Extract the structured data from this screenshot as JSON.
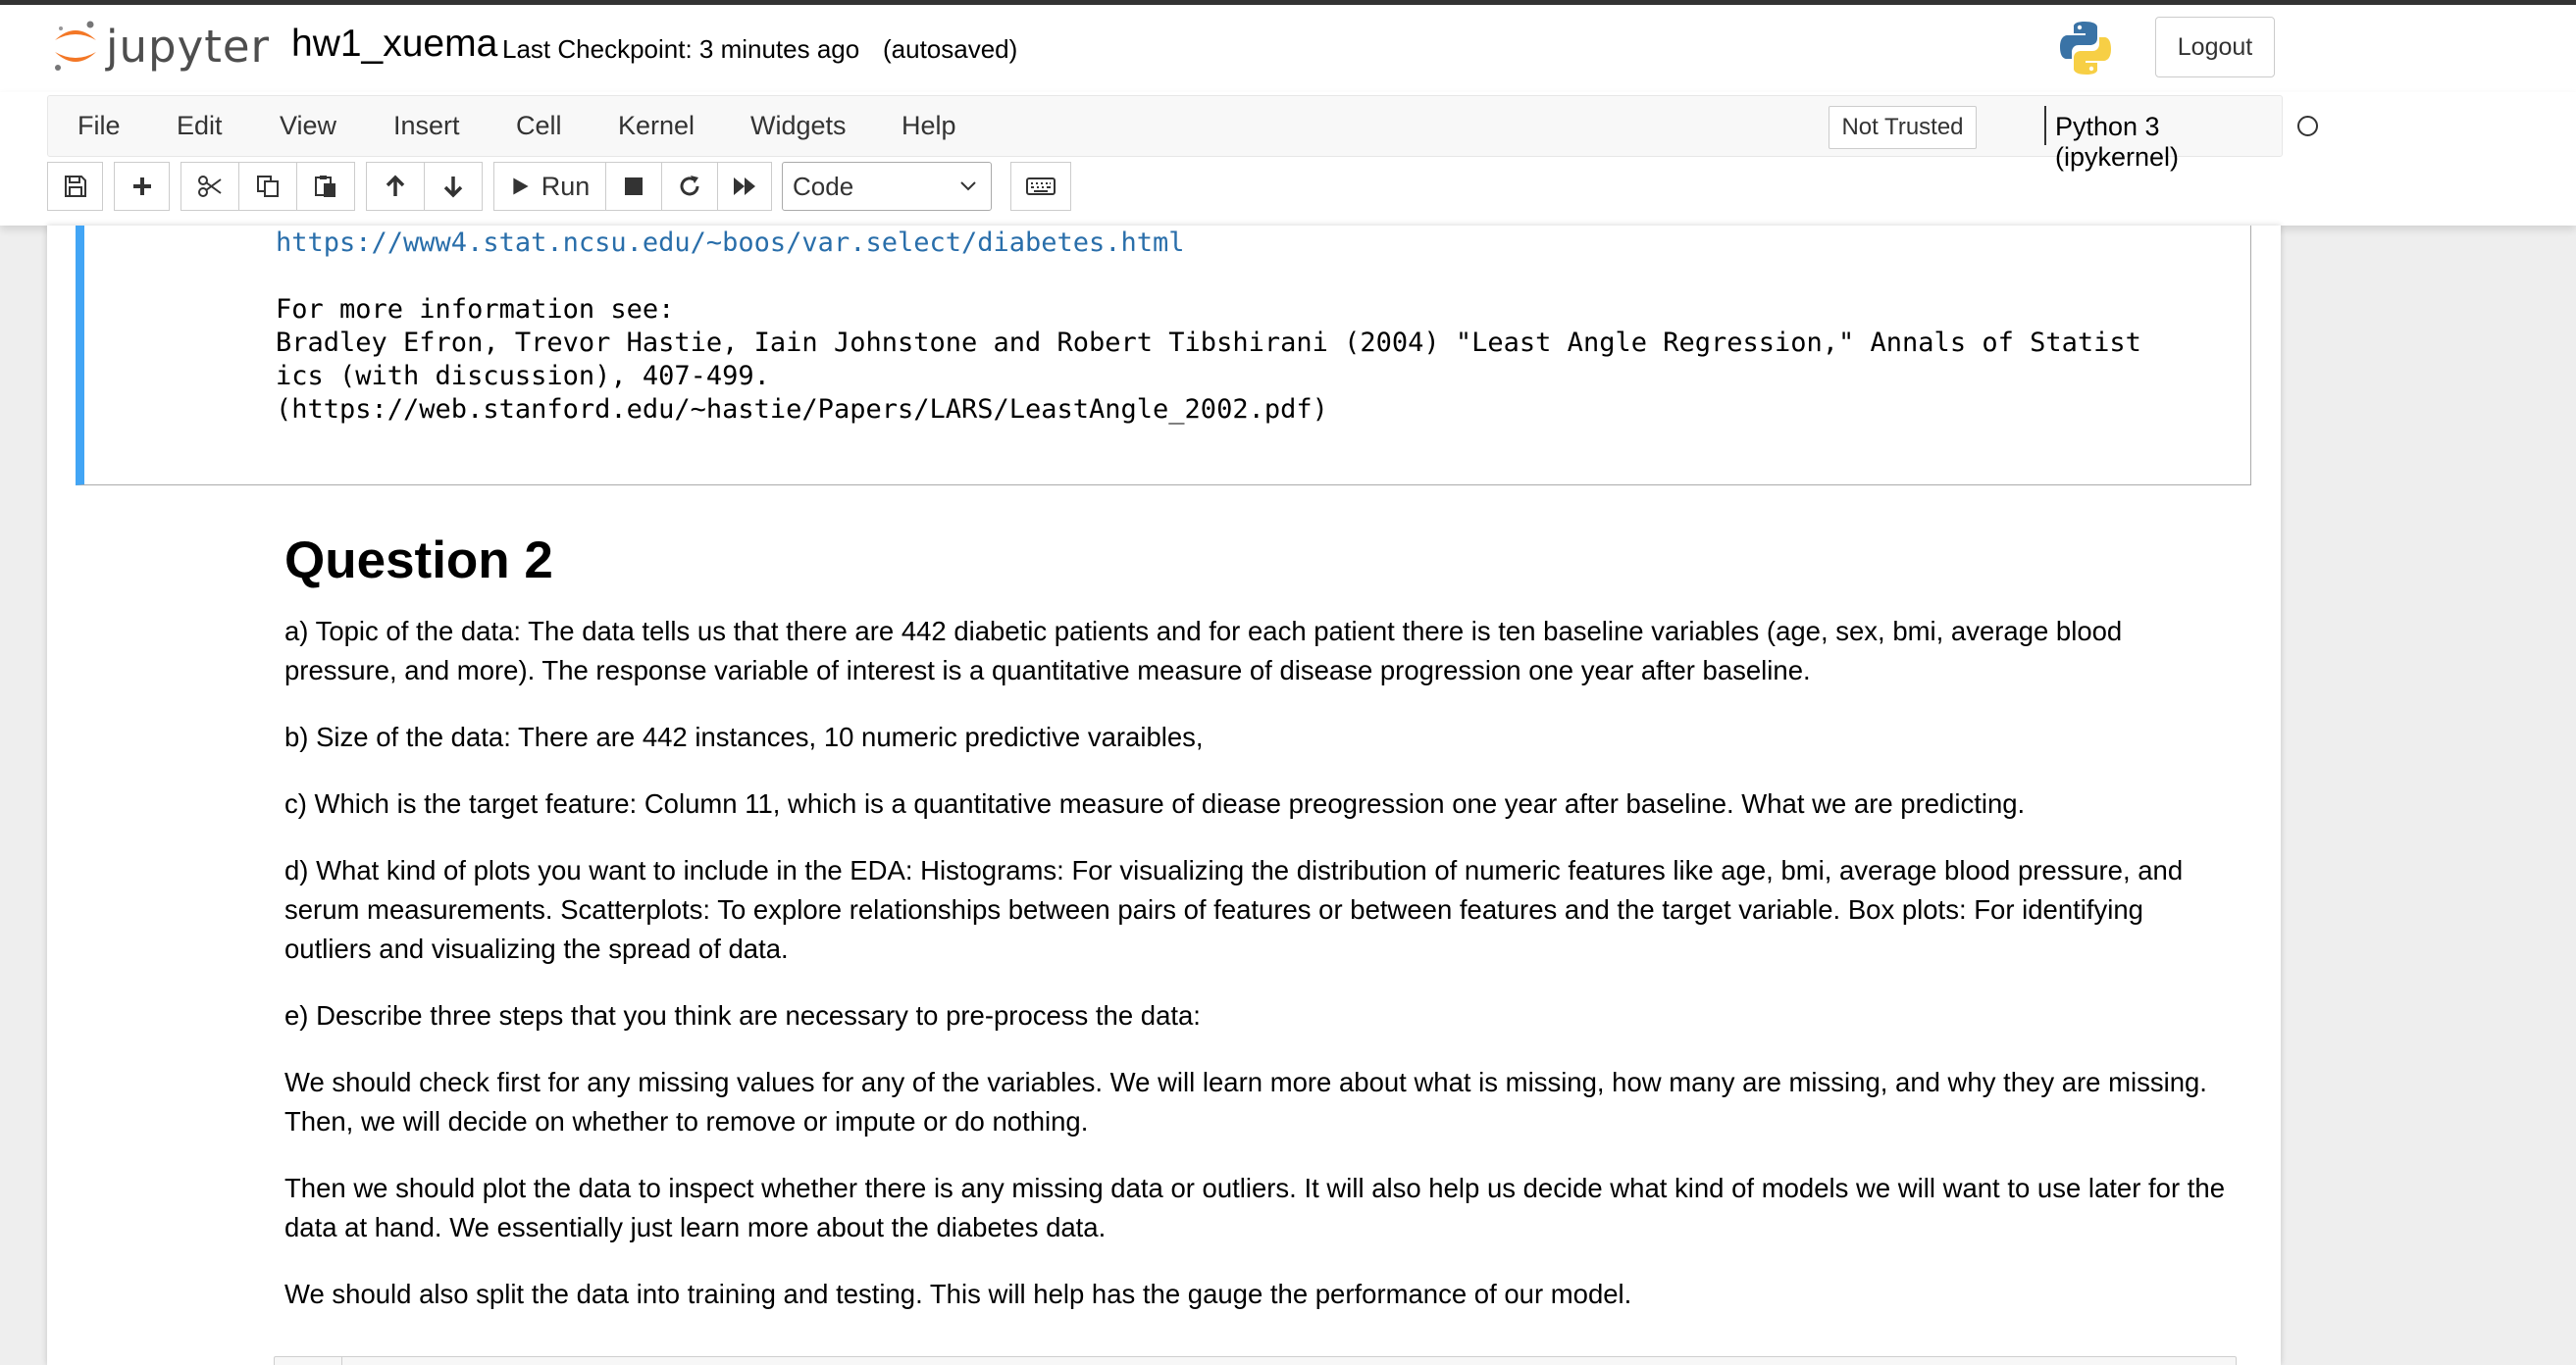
{
  "header": {
    "logo_text": "jupyter",
    "notebook_title": "hw1_xuema",
    "checkpoint": "Last Checkpoint: 3 minutes ago",
    "autosave": "(autosaved)",
    "logout_label": "Logout"
  },
  "menubar": {
    "items": [
      "File",
      "Edit",
      "View",
      "Insert",
      "Cell",
      "Kernel",
      "Widgets",
      "Help"
    ],
    "trust_label": "Not Trusted",
    "kernel_name": "Python 3 (ipykernel)"
  },
  "toolbar": {
    "run_label": "Run",
    "cell_type": "Code",
    "icons": [
      "save-icon",
      "plus-icon",
      "cut-icon",
      "copy-icon",
      "paste-icon",
      "arrow-up-icon",
      "arrow-down-icon",
      "play-icon",
      "stop-icon",
      "restart-icon",
      "fast-forward-icon",
      "chevron-down-icon",
      "keyboard-icon"
    ]
  },
  "output": {
    "link": "https://www4.stat.ncsu.edu/~boos/var.select/diabetes.html",
    "line_more": "For more information see:",
    "line_ref1": "Bradley Efron, Trevor Hastie, Iain Johnstone and Robert Tibshirani (2004) \"Least Angle Regression,\" Annals of Statist",
    "line_ref2": "ics (with discussion), 407-499.",
    "line_ref3": "(https://web.stanford.edu/~hastie/Papers/LARS/LeastAngle_2002.pdf)"
  },
  "markdown": {
    "heading": "Question 2",
    "paragraphs": [
      "a) Topic of the data: The data tells us that there are 442 diabetic patients and for each patient there is ten baseline variables (age, sex, bmi, average blood pressure, and more). The response variable of interest is a quantitative measure of disease progression one year after baseline.",
      "b) Size of the data: There are 442 instances, 10 numeric predictive varaibles,",
      "c) Which is the target feature: Column 11, which is a quantitative measure of diease preogression one year after baseline. What we are predicting.",
      "d) What kind of plots you want to include in the EDA: Histograms: For visualizing the distribution of numeric features like age, bmi, average blood pressure, and serum measurements. Scatterplots: To explore relationships between pairs of features or between features and the target variable. Box plots: For identifying outliers and visualizing the spread of data.",
      "e) Describe three steps that you think are necessary to pre-process the data:",
      "We should check first for any missing values for any of the variables. We will learn more about what is missing, how many are missing, and why they are missing. Then, we will decide on whether to remove or impute or do nothing.",
      "Then we should plot the data to inspect whether there is any missing data or outliers. It will also help us decide what kind of models we will want to use later for the data at hand. We essentially just learn more about the diabetes data.",
      "We should also split the data into training and testing. This will help has the gauge the performance of our model."
    ]
  },
  "colors": {
    "accent_cell_border": "#42a5f5",
    "link": "#296eaa",
    "logo_orange": "#f37726"
  }
}
